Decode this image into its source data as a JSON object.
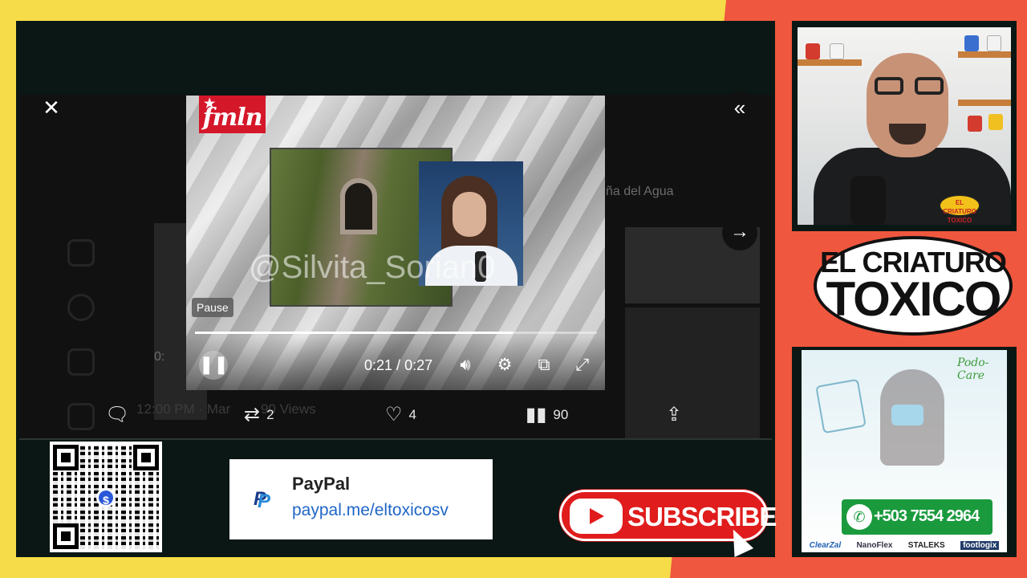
{
  "video": {
    "overlay_logo": "fmln",
    "watermark": "@Silvita_Sorian0",
    "pause_tooltip": "Pause",
    "current_time": "0:21",
    "duration": "0:27",
    "progress_fraction": 0.79
  },
  "tweet": {
    "actions": {
      "reply_count": "",
      "retweet_count": "2",
      "like_count": "4",
      "view_count": "90"
    },
    "faint_text": {
      "timestamp": "12:00 PM · Mar",
      "views_line": "90 Views",
      "side_text": "ña del Agua",
      "player_time": "0:"
    }
  },
  "paypal": {
    "title": "PayPal",
    "link": "paypal.me/eltoxicosv"
  },
  "subscribe": {
    "label": "SUBSCRIBE"
  },
  "brand": {
    "line1": "EL CRIATURO",
    "line2": "TOXICO",
    "shirt_badge": "EL CRIATURO TOXICO"
  },
  "ad": {
    "brand": "Podo-Care",
    "phone": "+503 7554 2964",
    "sponsors": [
      "ClearZal",
      "NanoFlex",
      "STALEKS",
      "footlogix"
    ]
  },
  "icons": {
    "close": "close-icon",
    "collapse": "double-chevron-left-icon",
    "next": "arrow-right-icon",
    "reply": "speech-bubble-icon",
    "retweet": "retweet-icon",
    "like": "heart-icon",
    "views": "bar-chart-icon",
    "share": "share-icon"
  },
  "colors": {
    "frame_yellow": "#f6dc48",
    "frame_red": "#f0573f",
    "youtube_red": "#e01c1c",
    "paypal_blue": "#1f66c7",
    "whatsapp_green": "#1a9a3d"
  }
}
